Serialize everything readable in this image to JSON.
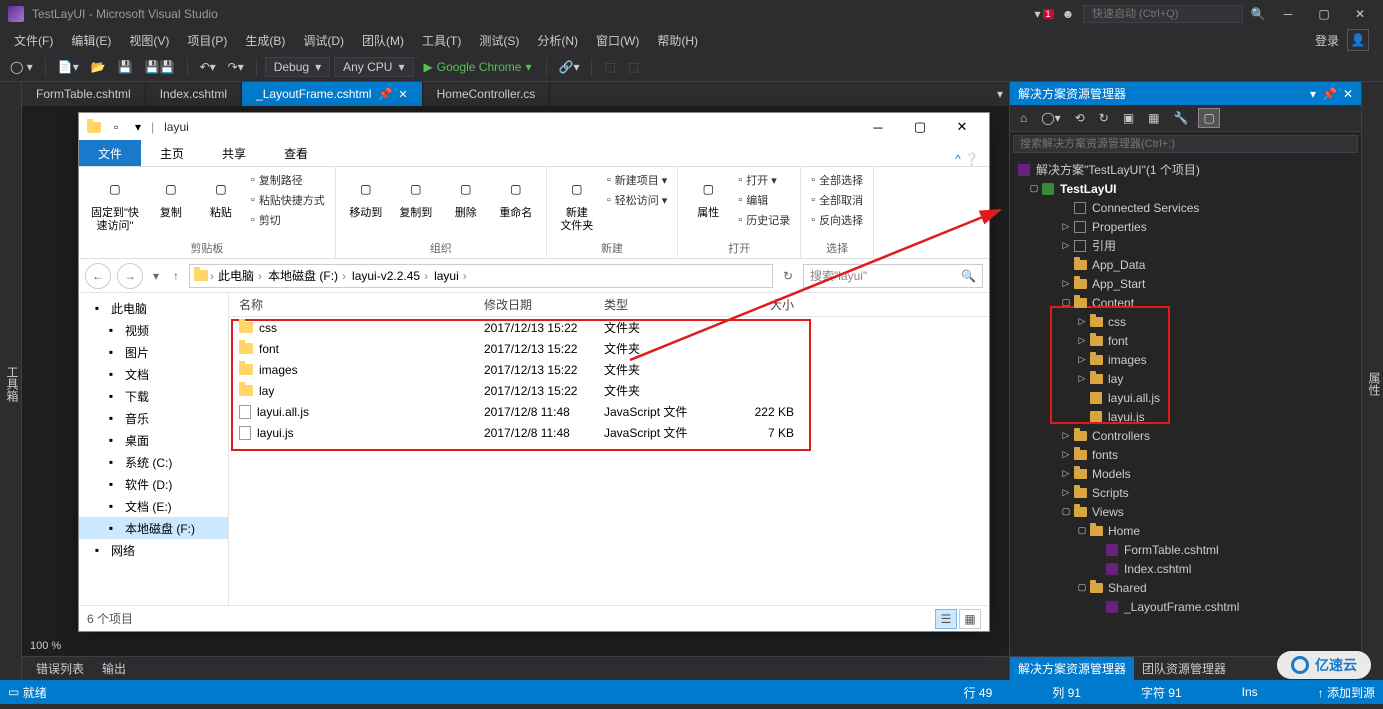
{
  "titlebar": {
    "title": "TestLayUI - Microsoft Visual Studio",
    "notif_badge": "1",
    "quick_launch_placeholder": "快速启动 (Ctrl+Q)"
  },
  "menubar": {
    "items": [
      "文件(F)",
      "编辑(E)",
      "视图(V)",
      "项目(P)",
      "生成(B)",
      "调试(D)",
      "团队(M)",
      "工具(T)",
      "测试(S)",
      "分析(N)",
      "窗口(W)",
      "帮助(H)"
    ],
    "login": "登录"
  },
  "toolbar": {
    "config": "Debug",
    "platform": "Any CPU",
    "start_label": "Google Chrome"
  },
  "left_strip": "工具箱",
  "right_strip": "属性",
  "doc_tabs": [
    {
      "label": "FormTable.cshtml",
      "active": false
    },
    {
      "label": "Index.cshtml",
      "active": false
    },
    {
      "label": "_LayoutFrame.cshtml",
      "active": true,
      "pinned": true
    },
    {
      "label": "HomeController.cs",
      "active": false
    }
  ],
  "zoom": "100 %",
  "bottom_tabs": [
    "错误列表",
    "输出"
  ],
  "statusbar": {
    "ready": "就绪",
    "line": "行 49",
    "col": "列 91",
    "char": "字符 91",
    "ins": "Ins",
    "add": "添加到源"
  },
  "solution": {
    "title": "解决方案资源管理器",
    "search_placeholder": "搜索解决方案资源管理器(Ctrl+;)",
    "root": "解决方案\"TestLayUI\"(1 个项目)",
    "project": "TestLayUI",
    "nodes": [
      {
        "label": "Connected Services",
        "icon": "svc",
        "depth": 2
      },
      {
        "label": "Properties",
        "icon": "wrench",
        "depth": 2,
        "exp": "▷"
      },
      {
        "label": "引用",
        "icon": "ref",
        "depth": 2,
        "exp": "▷"
      },
      {
        "label": "App_Data",
        "icon": "folder",
        "depth": 2
      },
      {
        "label": "App_Start",
        "icon": "folder",
        "depth": 2,
        "exp": "▷"
      },
      {
        "label": "Content",
        "icon": "folder",
        "depth": 2,
        "exp": "▢"
      },
      {
        "label": "css",
        "icon": "folder",
        "depth": 3,
        "exp": "▷",
        "boxed": true
      },
      {
        "label": "font",
        "icon": "folder",
        "depth": 3,
        "exp": "▷",
        "boxed": true
      },
      {
        "label": "images",
        "icon": "folder",
        "depth": 3,
        "exp": "▷",
        "boxed": true
      },
      {
        "label": "lay",
        "icon": "folder",
        "depth": 3,
        "exp": "▷",
        "boxed": true
      },
      {
        "label": "layui.all.js",
        "icon": "js",
        "depth": 3,
        "boxed": true
      },
      {
        "label": "layui.js",
        "icon": "js",
        "depth": 3,
        "boxed": true
      },
      {
        "label": "Controllers",
        "icon": "folder",
        "depth": 2,
        "exp": "▷"
      },
      {
        "label": "fonts",
        "icon": "folder",
        "depth": 2,
        "exp": "▷"
      },
      {
        "label": "Models",
        "icon": "folder",
        "depth": 2,
        "exp": "▷"
      },
      {
        "label": "Scripts",
        "icon": "folder",
        "depth": 2,
        "exp": "▷"
      },
      {
        "label": "Views",
        "icon": "folder",
        "depth": 2,
        "exp": "▢"
      },
      {
        "label": "Home",
        "icon": "folder",
        "depth": 3,
        "exp": "▢"
      },
      {
        "label": "FormTable.cshtml",
        "icon": "cshtml",
        "depth": 4
      },
      {
        "label": "Index.cshtml",
        "icon": "cshtml",
        "depth": 4
      },
      {
        "label": "Shared",
        "icon": "folder",
        "depth": 3,
        "exp": "▢"
      },
      {
        "label": "_LayoutFrame.cshtml",
        "icon": "cshtml",
        "depth": 4
      }
    ],
    "bottom_tabs": [
      "解决方案资源管理器",
      "团队资源管理器"
    ]
  },
  "explorer": {
    "title": "layui",
    "tabs": [
      "文件",
      "主页",
      "共享",
      "查看"
    ],
    "active_tab": 0,
    "ribbon": {
      "groups": [
        {
          "label": "剪贴板",
          "big": [
            {
              "l1": "固定到\"快",
              "l2": "速访问\""
            },
            {
              "l1": "复制"
            },
            {
              "l1": "粘贴"
            }
          ],
          "small": [
            "复制路径",
            "粘贴快捷方式",
            "剪切"
          ]
        },
        {
          "label": "组织",
          "big": [
            {
              "l1": "移动到"
            },
            {
              "l1": "复制到"
            },
            {
              "l1": "删除"
            },
            {
              "l1": "重命名"
            }
          ]
        },
        {
          "label": "新建",
          "big": [
            {
              "l1": "新建",
              "l2": "文件夹"
            }
          ],
          "small": [
            "新建项目 ▾",
            "轻松访问 ▾"
          ]
        },
        {
          "label": "打开",
          "big": [
            {
              "l1": "属性"
            }
          ],
          "small": [
            "打开 ▾",
            "编辑",
            "历史记录"
          ]
        },
        {
          "label": "选择",
          "small": [
            "全部选择",
            "全部取消",
            "反向选择"
          ]
        }
      ]
    },
    "breadcrumb": [
      "此电脑",
      "本地磁盘 (F:)",
      "layui-v2.2.45",
      "layui"
    ],
    "search_placeholder": "搜索\"layui\"",
    "nav": [
      {
        "label": "此电脑",
        "icon": "pc",
        "indent": false,
        "sel": false
      },
      {
        "label": "视频",
        "icon": "video",
        "indent": true
      },
      {
        "label": "图片",
        "icon": "pic",
        "indent": true
      },
      {
        "label": "文档",
        "icon": "doc",
        "indent": true
      },
      {
        "label": "下载",
        "icon": "dl",
        "indent": true
      },
      {
        "label": "音乐",
        "icon": "music",
        "indent": true
      },
      {
        "label": "桌面",
        "icon": "desk",
        "indent": true
      },
      {
        "label": "系统 (C:)",
        "icon": "drive",
        "indent": true
      },
      {
        "label": "软件 (D:)",
        "icon": "drive",
        "indent": true
      },
      {
        "label": "文档 (E:)",
        "icon": "drive",
        "indent": true
      },
      {
        "label": "本地磁盘 (F:)",
        "icon": "drive",
        "indent": true,
        "sel": true
      },
      {
        "label": "网络",
        "icon": "net",
        "indent": false
      }
    ],
    "columns": {
      "name": "名称",
      "date": "修改日期",
      "type": "类型",
      "size": "大小"
    },
    "files": [
      {
        "name": "css",
        "date": "2017/12/13 15:22",
        "type": "文件夹",
        "size": "",
        "icon": "folder"
      },
      {
        "name": "font",
        "date": "2017/12/13 15:22",
        "type": "文件夹",
        "size": "",
        "icon": "folder"
      },
      {
        "name": "images",
        "date": "2017/12/13 15:22",
        "type": "文件夹",
        "size": "",
        "icon": "folder"
      },
      {
        "name": "lay",
        "date": "2017/12/13 15:22",
        "type": "文件夹",
        "size": "",
        "icon": "folder"
      },
      {
        "name": "layui.all.js",
        "date": "2017/12/8 11:48",
        "type": "JavaScript 文件",
        "size": "222 KB",
        "icon": "js"
      },
      {
        "name": "layui.js",
        "date": "2017/12/8 11:48",
        "type": "JavaScript 文件",
        "size": "7 KB",
        "icon": "js"
      }
    ],
    "status": "6 个项目"
  },
  "watermark": "亿速云"
}
